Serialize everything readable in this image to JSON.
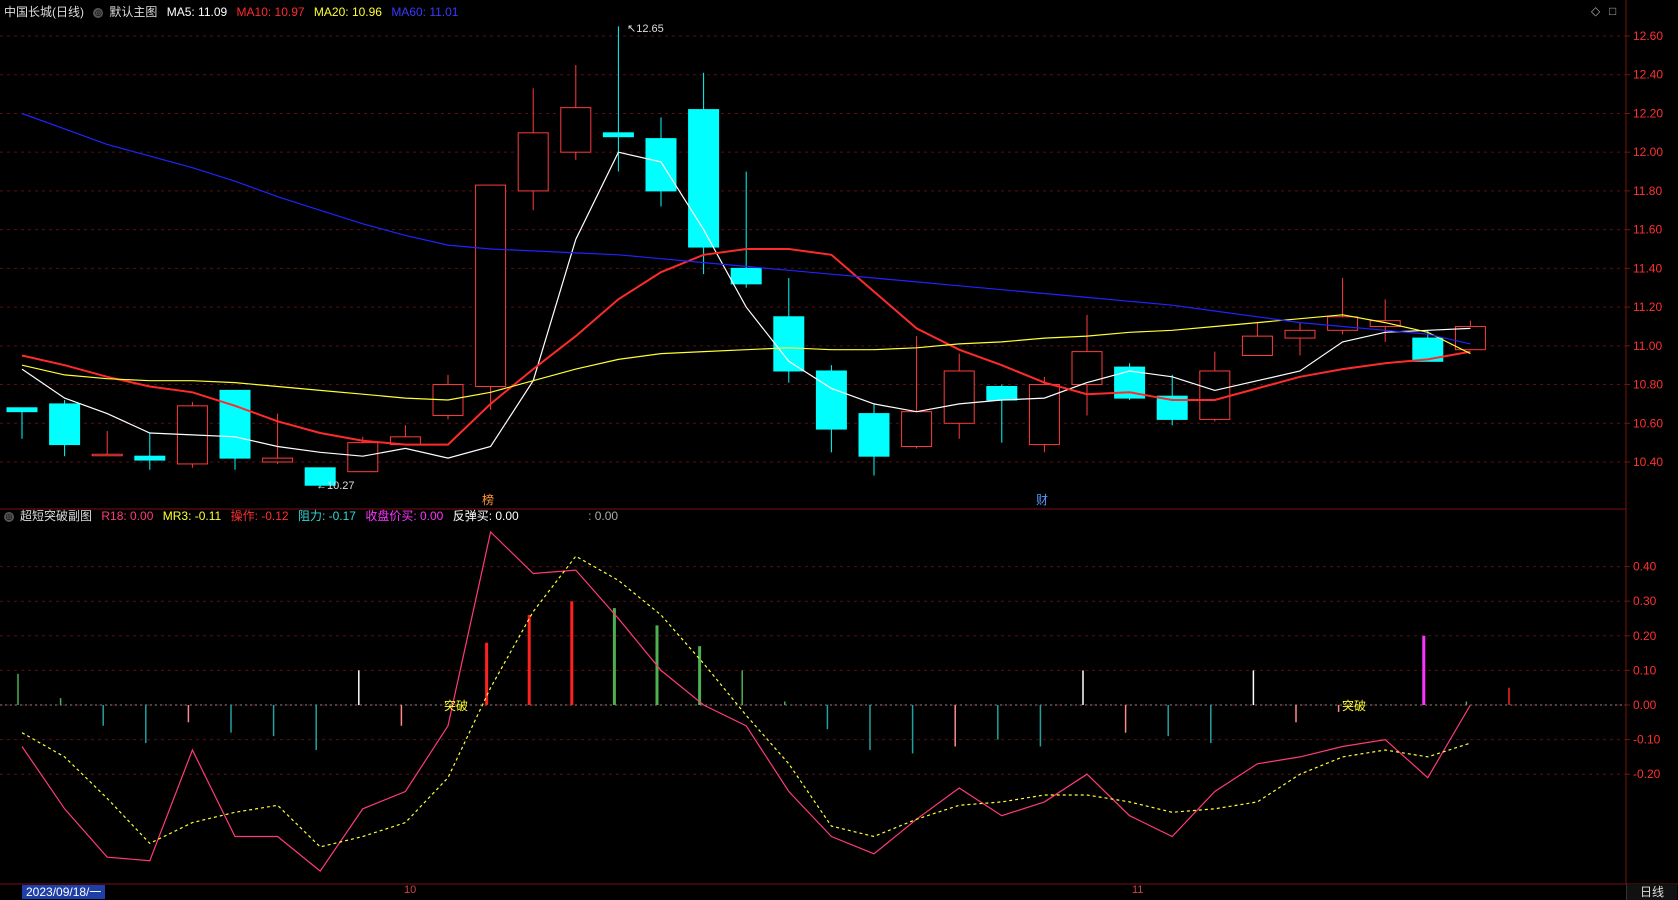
{
  "main": {
    "stock_name": "中国长城(日线)",
    "chart_name": "默认主图",
    "indicators": [
      {
        "label": "MA5: 11.09",
        "color": "#ffffff"
      },
      {
        "label": "MA10: 10.97",
        "color": "#ff2b2b"
      },
      {
        "label": "MA20: 10.96",
        "color": "#ffff33"
      },
      {
        "label": "MA60: 11.01",
        "color": "#2222ff"
      }
    ],
    "price_ticks": [
      "12.60",
      "12.40",
      "12.20",
      "12.00",
      "11.80",
      "11.60",
      "11.40",
      "11.20",
      "11.00",
      "10.80",
      "10.60",
      "10.40"
    ],
    "high_label": "12.65",
    "low_label": "10.27",
    "marker_left": "榜",
    "marker_right": "财"
  },
  "sub": {
    "title": "超短突破副图",
    "indicators": [
      {
        "label": "R18: 0.00",
        "color": "#ff3a7a"
      },
      {
        "label": "MR3: -0.11",
        "color": "#ffff33"
      },
      {
        "label": "操作: -0.12",
        "color": "#ff3030"
      },
      {
        "label": "阻力: -0.17",
        "color": "#33d6d6"
      },
      {
        "label": "收盘价买: 0.00",
        "color": "#ff33ff"
      },
      {
        "label": "反弹买: 0.00",
        "color": "#ffffff"
      },
      {
        "label": ": 0.00",
        "color": "#aaaaaa"
      }
    ],
    "ticks": [
      "0.40",
      "0.30",
      "0.20",
      "0.10",
      "0.00",
      "-0.10",
      "-0.20"
    ],
    "signal_label": "突破"
  },
  "footer": {
    "date_tag": "2023/09/18/一",
    "month_labels": [
      "10",
      "11"
    ],
    "period_button": "日线"
  },
  "icons": {
    "diamond": "diamond-icon",
    "window": "window-icon",
    "settings": "gear-icon"
  },
  "chart_data": [
    {
      "type": "candlestick",
      "ylim": [
        10.2,
        12.7
      ],
      "candles": [
        {
          "o": 10.68,
          "c": 10.66,
          "h": 10.68,
          "l": 10.52
        },
        {
          "o": 10.7,
          "c": 10.49,
          "h": 10.72,
          "l": 10.43
        },
        {
          "o": 10.44,
          "c": 10.44,
          "h": 10.56,
          "l": 10.44
        },
        {
          "o": 10.43,
          "c": 10.41,
          "h": 10.55,
          "l": 10.36
        },
        {
          "o": 10.39,
          "c": 10.69,
          "h": 10.71,
          "l": 10.37
        },
        {
          "o": 10.77,
          "c": 10.42,
          "h": 10.77,
          "l": 10.36
        },
        {
          "o": 10.4,
          "c": 10.42,
          "h": 10.65,
          "l": 10.39
        },
        {
          "o": 10.37,
          "c": 10.28,
          "h": 10.37,
          "l": 10.27
        },
        {
          "o": 10.35,
          "c": 10.5,
          "h": 10.53,
          "l": 10.35
        },
        {
          "o": 10.49,
          "c": 10.53,
          "h": 10.59,
          "l": 10.49
        },
        {
          "o": 10.64,
          "c": 10.8,
          "h": 10.85,
          "l": 10.62
        },
        {
          "o": 10.79,
          "c": 11.83,
          "h": 11.83,
          "l": 10.67
        },
        {
          "o": 11.8,
          "c": 12.1,
          "h": 12.33,
          "l": 11.7
        },
        {
          "o": 12.0,
          "c": 12.23,
          "h": 12.45,
          "l": 11.96
        },
        {
          "o": 12.1,
          "c": 12.08,
          "h": 12.65,
          "l": 11.9
        },
        {
          "o": 12.07,
          "c": 11.8,
          "h": 12.18,
          "l": 11.72
        },
        {
          "o": 12.22,
          "c": 11.51,
          "h": 12.41,
          "l": 11.37
        },
        {
          "o": 11.4,
          "c": 11.32,
          "h": 11.9,
          "l": 11.3
        },
        {
          "o": 11.15,
          "c": 10.87,
          "h": 11.35,
          "l": 10.81
        },
        {
          "o": 10.87,
          "c": 10.57,
          "h": 10.9,
          "l": 10.45
        },
        {
          "o": 10.65,
          "c": 10.43,
          "h": 10.7,
          "l": 10.33
        },
        {
          "o": 10.48,
          "c": 10.66,
          "h": 11.05,
          "l": 10.47
        },
        {
          "o": 10.6,
          "c": 10.87,
          "h": 10.96,
          "l": 10.52
        },
        {
          "o": 10.79,
          "c": 10.72,
          "h": 10.8,
          "l": 10.5
        },
        {
          "o": 10.49,
          "c": 10.8,
          "h": 10.84,
          "l": 10.45
        },
        {
          "o": 10.8,
          "c": 10.97,
          "h": 11.16,
          "l": 10.64
        },
        {
          "o": 10.89,
          "c": 10.73,
          "h": 10.91,
          "l": 10.72
        },
        {
          "o": 10.74,
          "c": 10.62,
          "h": 10.85,
          "l": 10.59
        },
        {
          "o": 10.62,
          "c": 10.87,
          "h": 10.97,
          "l": 10.61
        },
        {
          "o": 10.95,
          "c": 11.05,
          "h": 11.12,
          "l": 10.95
        },
        {
          "o": 11.04,
          "c": 11.08,
          "h": 11.12,
          "l": 10.95
        },
        {
          "o": 11.08,
          "c": 11.15,
          "h": 11.35,
          "l": 11.06
        },
        {
          "o": 11.1,
          "c": 11.13,
          "h": 11.24,
          "l": 11.02
        },
        {
          "o": 11.04,
          "c": 10.92,
          "h": 11.08,
          "l": 10.92
        },
        {
          "o": 10.98,
          "c": 11.1,
          "h": 11.13,
          "l": 10.98
        }
      ],
      "series": [
        {
          "name": "MA5",
          "color": "#ffffff",
          "values": [
            10.88,
            10.73,
            10.65,
            10.55,
            10.54,
            10.53,
            10.48,
            10.45,
            10.43,
            10.47,
            10.42,
            10.48,
            10.82,
            11.55,
            12.0,
            11.95,
            11.6,
            11.2,
            10.92,
            10.78,
            10.7,
            10.66,
            10.7,
            10.72,
            10.73,
            10.81,
            10.87,
            10.84,
            10.77,
            10.82,
            10.87,
            11.02,
            11.07,
            11.08,
            11.09
          ]
        },
        {
          "name": "MA10",
          "color": "#ff2b2b",
          "values": [
            10.95,
            10.9,
            10.84,
            10.79,
            10.76,
            10.69,
            10.61,
            10.55,
            10.51,
            10.49,
            10.49,
            10.7,
            10.88,
            11.05,
            11.24,
            11.38,
            11.47,
            11.5,
            11.5,
            11.47,
            11.28,
            11.09,
            10.98,
            10.9,
            10.81,
            10.75,
            10.76,
            10.72,
            10.72,
            10.78,
            10.84,
            10.88,
            10.91,
            10.93,
            10.97
          ]
        },
        {
          "name": "MA20",
          "color": "#ffff33",
          "values": [
            10.9,
            10.85,
            10.83,
            10.82,
            10.82,
            10.81,
            10.79,
            10.77,
            10.75,
            10.73,
            10.72,
            10.76,
            10.82,
            10.88,
            10.93,
            10.96,
            10.97,
            10.98,
            10.99,
            10.98,
            10.98,
            10.99,
            11.01,
            11.02,
            11.04,
            11.05,
            11.07,
            11.08,
            11.1,
            11.12,
            11.14,
            11.16,
            11.12,
            11.07,
            10.96
          ]
        },
        {
          "name": "MA60",
          "color": "#2222ff",
          "values": [
            12.2,
            12.12,
            12.04,
            11.98,
            11.92,
            11.85,
            11.77,
            11.7,
            11.63,
            11.57,
            11.52,
            11.5,
            11.49,
            11.48,
            11.47,
            11.45,
            11.43,
            11.41,
            11.39,
            11.37,
            11.35,
            11.33,
            11.31,
            11.29,
            11.27,
            11.25,
            11.23,
            11.21,
            11.18,
            11.15,
            11.12,
            11.1,
            11.08,
            11.06,
            11.01
          ]
        }
      ]
    },
    {
      "type": "bar",
      "ylim": [
        -0.5,
        0.5
      ],
      "series": [
        {
          "name": "R18",
          "color": "#ff3a7a",
          "values": [
            -0.12,
            -0.3,
            -0.44,
            -0.45,
            -0.13,
            -0.38,
            -0.38,
            -0.48,
            -0.3,
            -0.25,
            -0.06,
            0.5,
            0.38,
            0.39,
            0.25,
            0.1,
            0.0,
            -0.06,
            -0.25,
            -0.38,
            -0.43,
            -0.33,
            -0.24,
            -0.32,
            -0.28,
            -0.2,
            -0.32,
            -0.38,
            -0.25,
            -0.17,
            -0.15,
            -0.12,
            -0.1,
            -0.21,
            0.0
          ]
        },
        {
          "name": "MR3",
          "color": "#ffff33",
          "values": [
            -0.08,
            -0.15,
            -0.27,
            -0.4,
            -0.34,
            -0.31,
            -0.29,
            -0.41,
            -0.38,
            -0.34,
            -0.21,
            0.05,
            0.27,
            0.43,
            0.36,
            0.26,
            0.12,
            -0.03,
            -0.17,
            -0.35,
            -0.38,
            -0.33,
            -0.29,
            -0.28,
            -0.26,
            -0.26,
            -0.28,
            -0.31,
            -0.3,
            -0.28,
            -0.2,
            -0.15,
            -0.13,
            -0.15,
            -0.11
          ]
        },
        {
          "name": "bars",
          "values": [
            0.09,
            0.02,
            -0.06,
            -0.11,
            -0.05,
            -0.08,
            -0.09,
            -0.13,
            0.1,
            -0.06,
            0.0,
            0.18,
            0.26,
            0.3,
            0.28,
            0.23,
            0.17,
            0.1,
            0.01,
            -0.07,
            -0.13,
            -0.14,
            -0.12,
            -0.1,
            -0.12,
            0.1,
            -0.08,
            -0.09,
            -0.11,
            0.1,
            -0.05,
            -0.02,
            0.0,
            0.2,
            0.01,
            0.05
          ]
        },
        {
          "name": "bar_colors",
          "values": [
            "#4caf50",
            "#4caf50",
            "#22a0a0",
            "#22a0a0",
            "#ff8888",
            "#22a0a0",
            "#22a0a0",
            "#22a0a0",
            "#ffffff",
            "#ff8888",
            "#4caf50",
            "#ff2020",
            "#ff2020",
            "#ff2020",
            "#4caf50",
            "#4caf50",
            "#4caf50",
            "#4caf50",
            "#4caf50",
            "#22a0a0",
            "#22a0a0",
            "#22a0a0",
            "#ff8888",
            "#22a0a0",
            "#22a0a0",
            "#ffffff",
            "#ff8888",
            "#22a0a0",
            "#22a0a0",
            "#ffffff",
            "#ff8888",
            "#ff8888",
            "#4caf50",
            "#ff33ff",
            "#4caf50",
            "#ff2020"
          ]
        }
      ]
    }
  ]
}
